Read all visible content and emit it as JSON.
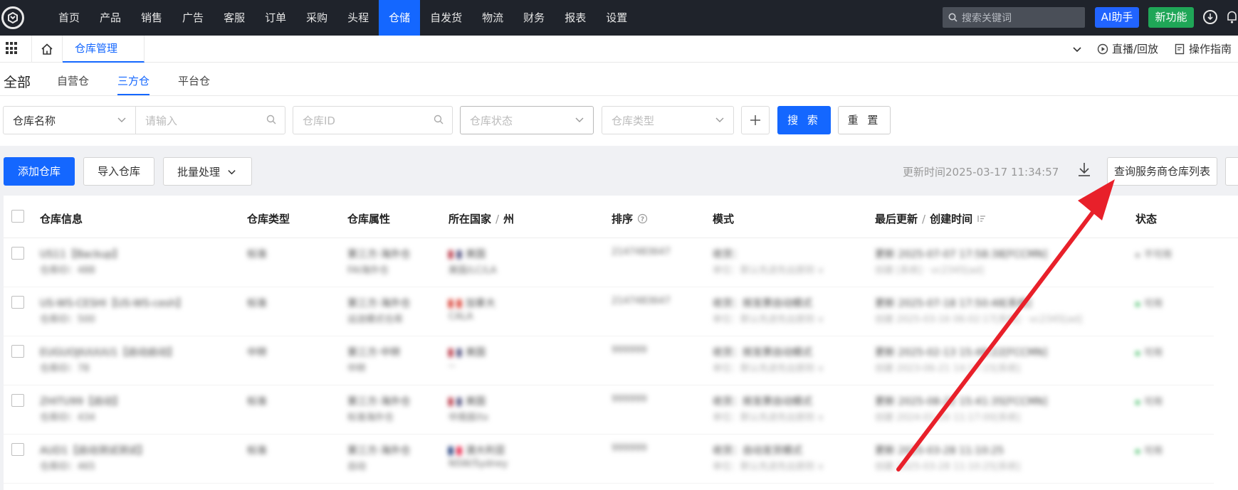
{
  "nav": {
    "items": [
      "首页",
      "产品",
      "销售",
      "广告",
      "客服",
      "订单",
      "采购",
      "头程",
      "仓储",
      "自发货",
      "物流",
      "财务",
      "报表",
      "设置"
    ],
    "active_index": 8,
    "search_placeholder": "搜索关键词",
    "ai_label": "AI助手",
    "new_label": "新功能"
  },
  "tabbar": {
    "page_tab": "仓库管理",
    "live_label": "直播/回放",
    "guide_label": "操作指南"
  },
  "subtabs": {
    "all": "全部",
    "items": [
      "自营仓",
      "三方仓",
      "平台仓"
    ],
    "active_index": 1
  },
  "filter": {
    "field_select": "仓库名称",
    "input_placeholder": "请输入",
    "id_placeholder": "仓库ID",
    "status_placeholder": "仓库状态",
    "type_placeholder": "仓库类型",
    "search_label": "搜 索",
    "reset_label": "重 置"
  },
  "toolbar": {
    "add_label": "添加仓库",
    "import_label": "导入仓库",
    "batch_label": "批量处理",
    "update_time": "更新时间2025-03-17 11:34:57",
    "query_label": "查询服务商仓库列表"
  },
  "table": {
    "headers": {
      "info": "仓库信息",
      "type": "仓库类型",
      "attr": "仓库属性",
      "country": "所在国家",
      "state": "州",
      "sort": "排序",
      "mode": "模式",
      "last_update": "最后更新",
      "create_time": "创建时间",
      "status": "状态"
    },
    "rows": [
      {
        "name": "US11【Backup】",
        "id": "仓库ID：488",
        "type": "标准",
        "attr1": "第三方·海外仓",
        "attr2": "FAI海外仓",
        "country": "美国",
        "state": "美国/LC/LA",
        "sort": "2147483647",
        "mode1": "收货：",
        "mode2": "单位：默认先进先出原则 ∨",
        "upd1": "更新 2025-07-07 17:58:38[FCCMN]",
        "upd2": "创建 [系统] · vc2345[ad]",
        "status": "不可用",
        "status_color": "#999999"
      },
      {
        "name": "US-WS-CESHI【US-WS-cesh】",
        "id": "仓库ID：500",
        "type": "标准",
        "attr1": "第三方·海外仓",
        "attr2": "运送模式仓库",
        "country": "加拿大",
        "state": "CALA",
        "sort": "2147483647",
        "mode1": "收货：按发票自动模式",
        "mode2": "单位：默认先进先出原则 ∨",
        "upd1": "更新 2025-07-18 17:50:48[系统]",
        "upd2": "创建 2025-03-16 06:02:17[系统] · vc2345[ad]",
        "status": "可用",
        "status_color": "#22b14c"
      },
      {
        "name": "EUGUOJIUUUU1【启动启动】",
        "id": "仓库ID：78",
        "type": "中转",
        "attr1": "第三方·中转",
        "attr2": "中转",
        "country": "美国",
        "state": "--",
        "sort": "999999",
        "mode1": "收货：按发票自动模式",
        "mode2": "单位：默认先进先出原则 ∨",
        "upd1": "更新 2025-02-13 15:48:22[FCCMN]",
        "upd2": "创建 2023-06-21 14:17:15[系统]",
        "status": "可用",
        "status_color": "#22b14c"
      },
      {
        "name": "ZHITU99【启动】",
        "id": "仓库ID：434",
        "type": "标准",
        "attr1": "第三方·海外仓",
        "attr2": "标准海外仓",
        "country": "美国",
        "state": "中南部/tx",
        "sort": "999999",
        "mode1": "收货：按发票自动模式",
        "mode2": "单位：默认先进先出原则 ∨",
        "upd1": "更新 2025-08-22 15:41:35[FCCMN]",
        "upd2": "创建 2024-01-26 11:17:00[系统]",
        "status": "可用",
        "status_color": "#22b14c"
      },
      {
        "name": "AUD1【启动测试测试】",
        "id": "仓库ID：465",
        "type": "标准",
        "attr1": "第三方·海外仓",
        "attr2": "自动",
        "country": "澳大利亚",
        "state": "NSW/Sydney",
        "sort": "999999",
        "mode1": "收货：自动发货模式",
        "mode2": "单位：默认先进先出原则 ∨",
        "upd1": "更新 2025-03-28 11:10:25",
        "upd2": "创建 2025-03-28 11:10:25[系统]",
        "status": "可用",
        "status_color": "#22b14c"
      }
    ]
  },
  "colors": {
    "accent": "#1467ff",
    "nav_bg": "#1f232b",
    "new_green": "#1fa657",
    "arrow": "#e8202a"
  }
}
